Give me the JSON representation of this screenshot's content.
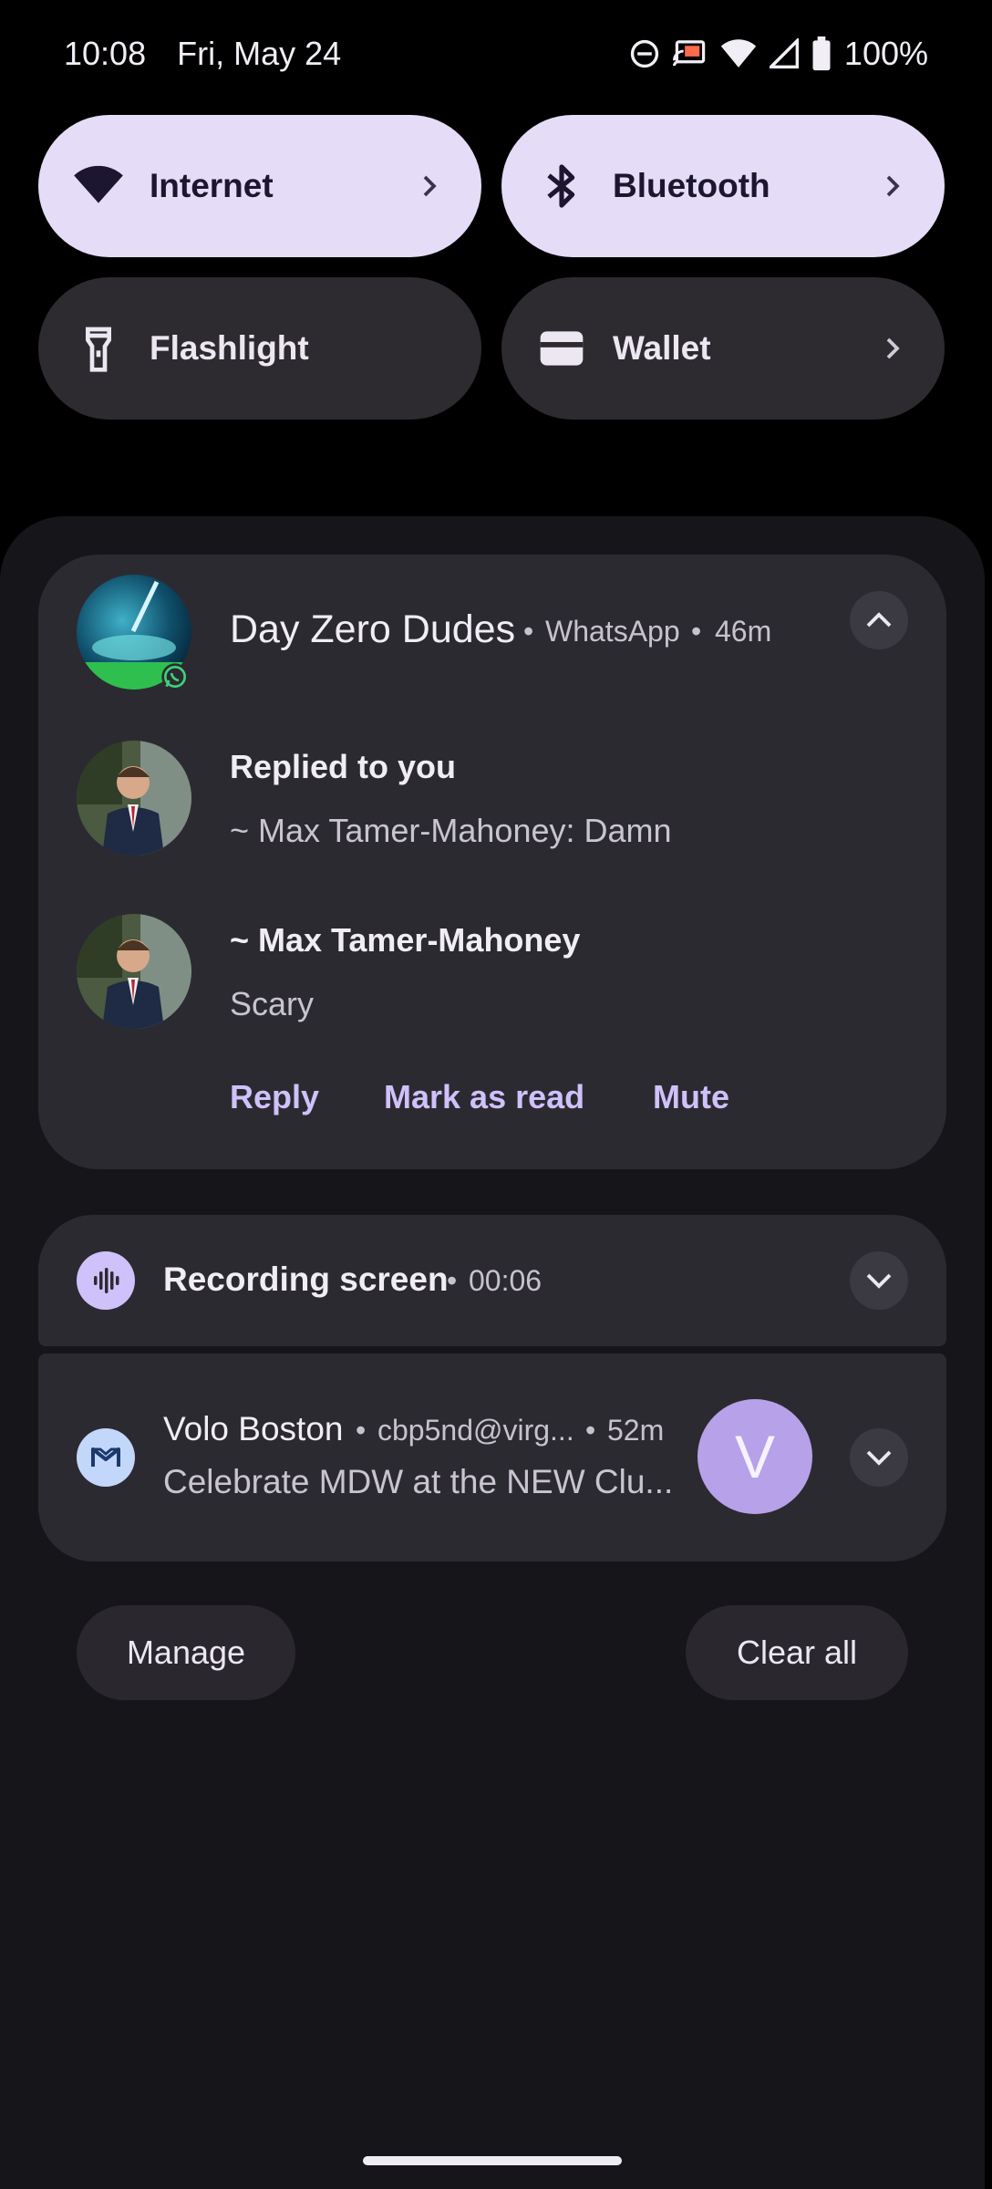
{
  "status_bar": {
    "time": "10:08",
    "date": "Fri, May 24",
    "battery": "100%",
    "icons": [
      "do-not-disturb-icon",
      "cast-icon",
      "wifi-icon",
      "cell-signal-icon",
      "battery-icon"
    ]
  },
  "quick_tiles": [
    {
      "label": "Internet",
      "icon": "wifi-icon",
      "active": true
    },
    {
      "label": "Bluetooth",
      "icon": "bluetooth-icon",
      "active": true
    },
    {
      "label": "Flashlight",
      "icon": "flashlight-icon",
      "active": false
    },
    {
      "label": "Wallet",
      "icon": "wallet-icon",
      "active": false
    }
  ],
  "conversation": {
    "title": "Day Zero Dudes",
    "app": "WhatsApp",
    "age": "46m",
    "messages": [
      {
        "sender": "Replied to you",
        "text": "~ Max Tamer-Mahoney: Damn"
      },
      {
        "sender": "~ Max Tamer-Mahoney",
        "text": "Scary"
      }
    ],
    "actions": [
      "Reply",
      "Mark as read",
      "Mute"
    ]
  },
  "recording": {
    "title": "Recording screen",
    "elapsed": "00:06"
  },
  "email": {
    "sender": "Volo Boston",
    "account": "cbp5nd@virg...",
    "age": "52m",
    "preview": "Celebrate MDW at the NEW Clu...",
    "avatar_letter": "V"
  },
  "footer": {
    "manage": "Manage",
    "clear_all": "Clear all"
  },
  "colors": {
    "accent": "#cfc1fa",
    "tile_active": "#e5ddf7",
    "card": "#2c2a31",
    "avatar_v": "#b7a1e8"
  },
  "separator": "•"
}
